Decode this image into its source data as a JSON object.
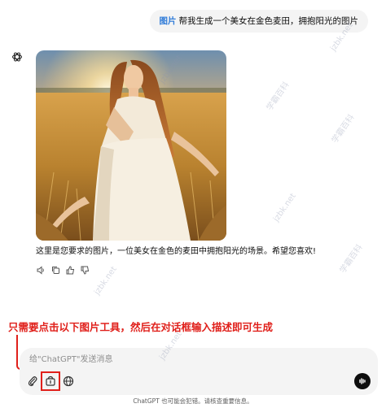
{
  "user_message": {
    "tag": "图片",
    "text": "帮我生成一个美女在金色麦田，拥抱阳光的图片"
  },
  "assistant": {
    "avatar_icon": "chatgpt-logo-icon",
    "image_alt": "美女在金色麦田拥抱阳光",
    "reply_text": "这里是您要求的图片，一位美女在金色的麦田中拥抱阳光的场景。希望您喜欢!",
    "actions": [
      "speaker-icon",
      "copy-icon",
      "thumbs-up-icon",
      "thumbs-down-icon"
    ]
  },
  "annotation": {
    "text": "只需要点击以下图片工具，然后在对话框输入描述即可生成",
    "color": "#e0201b"
  },
  "composer": {
    "placeholder": "给\"ChatGPT\"发送消息",
    "tools": [
      "paperclip-icon",
      "image-tool-icon",
      "globe-icon"
    ],
    "send_icon": "voice-icon"
  },
  "footer_note": "ChatGPT 也可能会犯错。请核查重要信息。",
  "watermark": {
    "text": "jzbk.net",
    "brand": "学霸百科"
  },
  "colors": {
    "user_bubble": "#f4f4f4",
    "tag": "#2f7bd8",
    "annotation": "#e0201b"
  }
}
